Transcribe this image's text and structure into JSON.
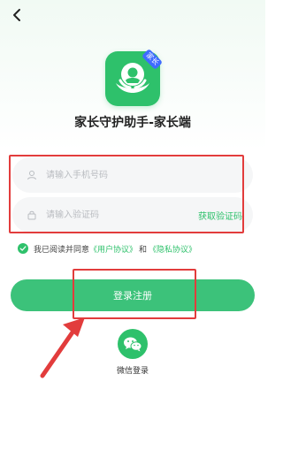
{
  "app": {
    "title": "家长守护助手-家长端",
    "icon_badge": "家长"
  },
  "form": {
    "phone_placeholder": "请输入手机号码",
    "code_placeholder": "请输入验证码",
    "get_code_label": "获取验证码"
  },
  "agreement": {
    "prefix": "我已阅读并同意",
    "user_agreement": "《用户协议》",
    "and": "和",
    "privacy_agreement": "《隐私协议》"
  },
  "actions": {
    "primary_label": "登录注册",
    "wechat_label": "微信登录"
  },
  "colors": {
    "accent": "#2ec16b",
    "primary_button": "#3cc27a",
    "annotation": "#e23c3c",
    "badge": "#3f6bff"
  },
  "icons": {
    "back": "chevron-left-icon",
    "app": "parent-child-hands-icon",
    "phone": "user-icon",
    "code": "lock-icon",
    "check": "check-icon",
    "wechat": "wechat-icon"
  }
}
